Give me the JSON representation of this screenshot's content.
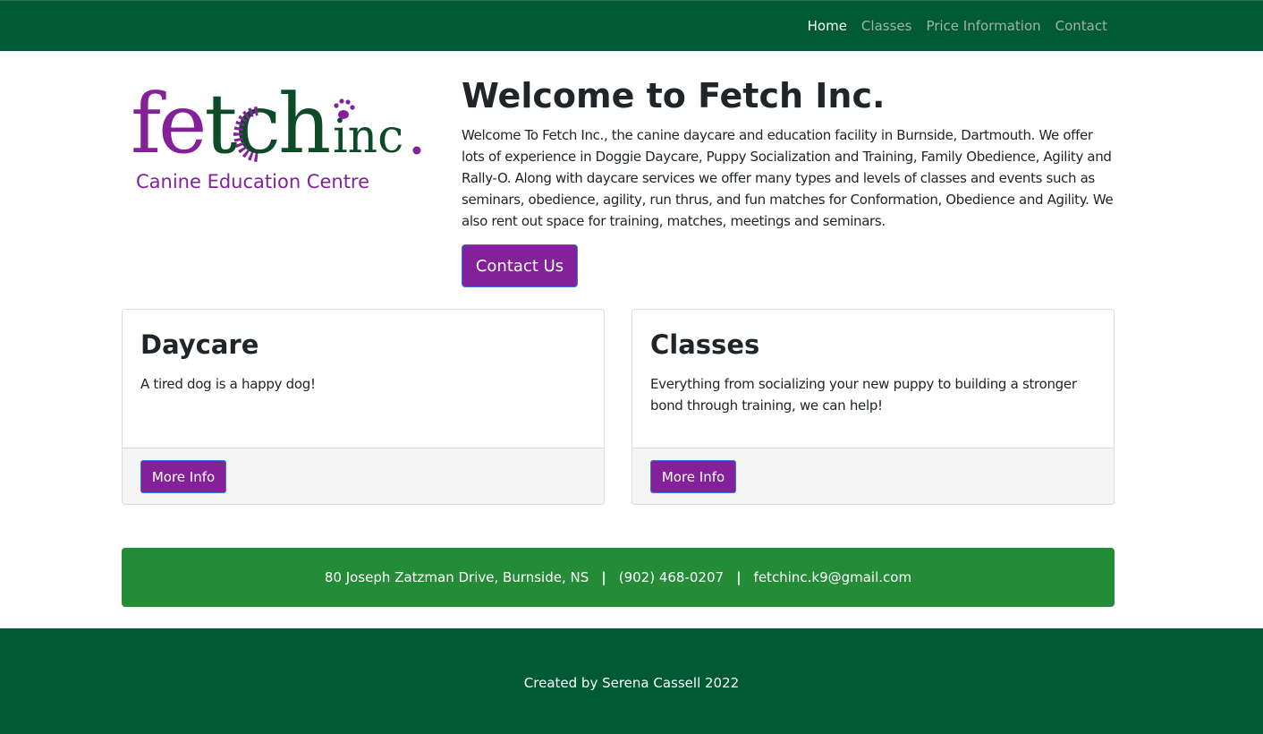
{
  "nav": {
    "items": [
      {
        "label": "Home",
        "active": true
      },
      {
        "label": "Classes",
        "active": false
      },
      {
        "label": "Price Information",
        "active": false
      },
      {
        "label": "Contact",
        "active": false
      }
    ]
  },
  "logo": {
    "wordmark_main": "fetch",
    "wordmark_suffix": "inc.",
    "tagline": "Canine Education Centre"
  },
  "hero": {
    "title": "Welcome to Fetch Inc.",
    "body": "Welcome To Fetch Inc., the canine daycare and education facility in Burnside, Dartmouth. We offer lots of experience in Doggie Daycare, Puppy Socialization and Training, Family Obedience, Agility and Rally-O. Along with daycare services we offer many types and levels of classes and events such as seminars, obedience, agility, run thrus, and fun matches for Conformation, Obedience and Agility. We also rent out space for training, matches, meetings and seminars.",
    "button_label": "Contact Us"
  },
  "cards": [
    {
      "title": "Daycare",
      "text": "A tired dog is a happy dog!",
      "button_label": "More Info"
    },
    {
      "title": "Classes",
      "text": "Everything from socializing your new puppy to building a stronger bond through training, we can help!",
      "button_label": "More Info"
    }
  ],
  "info_bar": {
    "address": "80 Joseph Zatzman Drive, Burnside, NS",
    "phone": "(902) 468-0207",
    "email": "fetchinc.k9@gmail.com",
    "separator": "|"
  },
  "footer": {
    "text": "Created by Serena Cassell 2022"
  },
  "colors": {
    "brand_green": "#005a34",
    "info_green": "#248b37",
    "brand_purple": "#84209a",
    "logo_dark_green": "#0d4a26"
  }
}
